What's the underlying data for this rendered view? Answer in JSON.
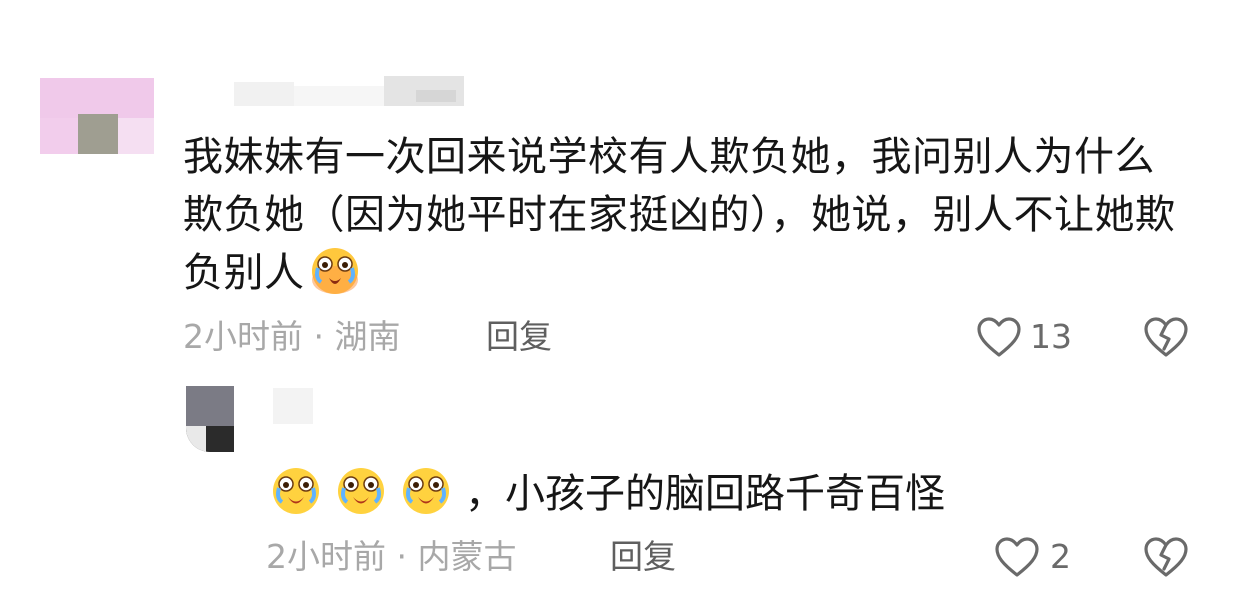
{
  "comments": [
    {
      "text": "我妹妹有一次回来说学校有人欺负她，我问别人为什么欺负她（因为她平时在家挺凶的），她说，别人不让她欺负别人",
      "trailing_emoji": "crying-laughing-emoji",
      "meta": "2小时前 · 湖南",
      "reply_label": "回复",
      "like_count": "13"
    },
    {
      "emojis": [
        "crying-laughing-emoji",
        "crying-laughing-emoji",
        "crying-laughing-emoji"
      ],
      "text": "，小孩子的脑回路千奇百怪",
      "meta": "2小时前 · 内蒙古",
      "reply_label": "回复",
      "like_count": "2"
    }
  ],
  "colors": {
    "text": "#161616",
    "meta": "#a8a8a8",
    "reply": "#5f5f5f",
    "icon": "#6a6a6a"
  }
}
